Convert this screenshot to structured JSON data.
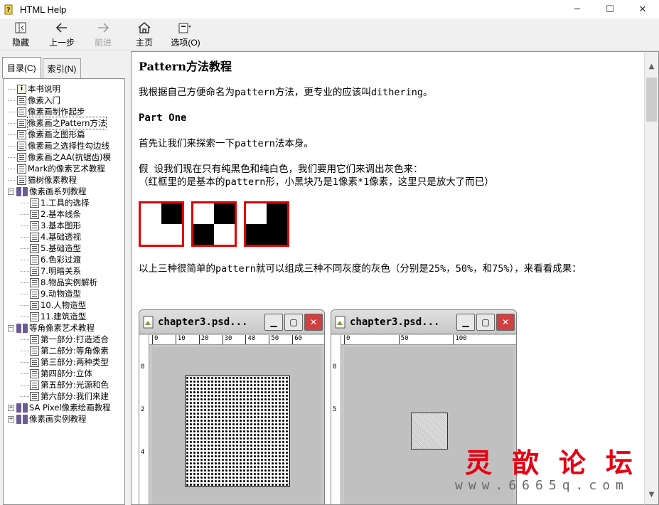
{
  "window": {
    "title": "HTML Help"
  },
  "toolbar": {
    "hide": "隐藏",
    "back": "上一步",
    "forward": "前进",
    "home": "主页",
    "options": "选项(O)"
  },
  "tabs": {
    "contents": "目录(C)",
    "index": "索引(N)"
  },
  "tree": [
    {
      "label": "本书说明",
      "icon": "info-icon",
      "level": 0
    },
    {
      "label": "像素入门",
      "icon": "page-icon",
      "level": 0
    },
    {
      "label": "像素画制作起步",
      "icon": "page-icon",
      "level": 0
    },
    {
      "label": "像素画之Pattern方法",
      "icon": "page-icon",
      "level": 0,
      "selected": true
    },
    {
      "label": "像素画之图形篇",
      "icon": "page-icon",
      "level": 0
    },
    {
      "label": "像素画之选择性勾边线",
      "icon": "page-icon",
      "level": 0
    },
    {
      "label": "像素画之AA(抗锯齿)模",
      "icon": "page-icon",
      "level": 0
    },
    {
      "label": "Mark的像素艺术教程",
      "icon": "page-icon",
      "level": 0
    },
    {
      "label": "猫树像素教程",
      "icon": "page-icon",
      "level": 0
    },
    {
      "label": "像素画系列教程",
      "icon": "book-open-icon",
      "level": 0,
      "expander": "−"
    },
    {
      "label": "1.工具的选择",
      "icon": "page-icon",
      "level": 1
    },
    {
      "label": "2.基本线条",
      "icon": "page-icon",
      "level": 1
    },
    {
      "label": "3.基本图形",
      "icon": "page-icon",
      "level": 1
    },
    {
      "label": "4.基础透视",
      "icon": "page-icon",
      "level": 1
    },
    {
      "label": "5.基础造型",
      "icon": "page-icon",
      "level": 1
    },
    {
      "label": "6.色彩过渡",
      "icon": "page-icon",
      "level": 1
    },
    {
      "label": "7.明暗关系",
      "icon": "page-icon",
      "level": 1
    },
    {
      "label": "8.物品实例解析",
      "icon": "page-icon",
      "level": 1
    },
    {
      "label": "9.动物造型",
      "icon": "page-icon",
      "level": 1
    },
    {
      "label": "10.人物造型",
      "icon": "page-icon",
      "level": 1
    },
    {
      "label": "11.建筑造型",
      "icon": "page-icon",
      "level": 1
    },
    {
      "label": "等角像素艺术教程",
      "icon": "book-open-icon",
      "level": 0,
      "expander": "−"
    },
    {
      "label": "第一部分:打造适合",
      "icon": "page-icon",
      "level": 1
    },
    {
      "label": "第二部分:等角像素",
      "icon": "page-icon",
      "level": 1
    },
    {
      "label": "第三部分:两种类型",
      "icon": "page-icon",
      "level": 1
    },
    {
      "label": "第四部分:立体",
      "icon": "page-icon",
      "level": 1
    },
    {
      "label": "第五部分:光源和色",
      "icon": "page-icon",
      "level": 1
    },
    {
      "label": "第六部分:我们来建",
      "icon": "page-icon",
      "level": 1
    },
    {
      "label": "SA Pixel像素绘画教程",
      "icon": "book-icon",
      "level": 0,
      "expander": "+"
    },
    {
      "label": "像素画实例教程",
      "icon": "book-icon",
      "level": 0,
      "expander": "+"
    }
  ],
  "article": {
    "title": "Pattern方法教程",
    "p1": "我根据自己方便命名为pattern方法，更专业的应该叫dithering。",
    "part": "Part One",
    "p2": "首先让我们来探索一下pattern法本身。",
    "p3a": "假 设我们现在只有纯黑色和纯白色，我们要用它们来调出灰色来：",
    "p3b": "（红框里的是基本的pattern形，小黑块乃是1像素*1像素，这里只是放大了而已）",
    "p4": "以上三种很简单的pattern就可以组成三种不同灰度的灰色（分别是25%，50%，和75%），来看看成果："
  },
  "psd_windows": [
    {
      "title": "chapter3.psd...",
      "ruler_top": [
        "0",
        "10",
        "20",
        "30",
        "40",
        "50",
        "60"
      ],
      "ruler_left": [
        "0",
        "2",
        "4"
      ]
    },
    {
      "title": "chapter3.psd...",
      "ruler_top": [
        "0",
        "50",
        "100"
      ],
      "ruler_left": [
        "0",
        "5"
      ]
    }
  ],
  "watermark": {
    "line1": "灵歆论坛",
    "line2": "www.6665q.com"
  },
  "colors": {
    "accent_red": "#e00000",
    "watermark_red": "#e60012"
  }
}
